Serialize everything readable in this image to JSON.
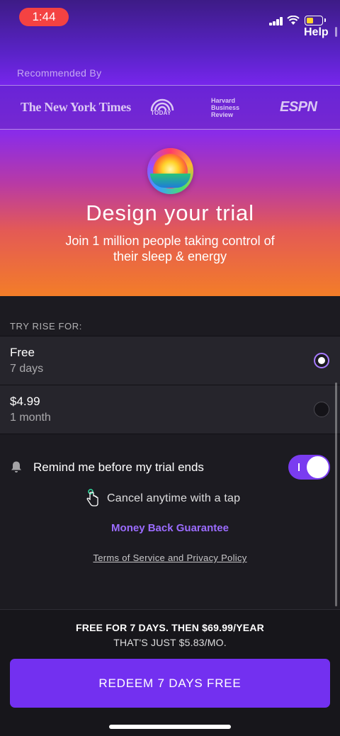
{
  "status_bar": {
    "time": "1:44",
    "help_label": "Help"
  },
  "press": {
    "label": "Recommended By",
    "logos": [
      "The New York Times",
      "TODAY",
      "Harvard Business Review",
      "ESPN"
    ]
  },
  "hero": {
    "title": "Design your trial",
    "subtitle_line1": "Join 1 million people taking control of",
    "subtitle_line2": "their sleep & energy"
  },
  "plans": {
    "section_label": "TRY RISE FOR:",
    "options": [
      {
        "title": "Free",
        "subtitle": "7 days",
        "selected": true
      },
      {
        "title": "$4.99",
        "subtitle": "1 month",
        "selected": false
      }
    ]
  },
  "reminder": {
    "label": "Remind me before my trial ends",
    "enabled": true
  },
  "cancel_note": "Cancel anytime with a tap",
  "guarantee_label": "Money Back Guarantee",
  "terms_label": "Terms of Service and Privacy Policy",
  "footer": {
    "price_line1": "FREE FOR 7 DAYS. THEN $69.99/YEAR",
    "price_line2": "THAT'S JUST $5.83/MO.",
    "cta_label": "REDEEM 7 DAYS FREE"
  },
  "colors": {
    "accent": "#7330f0",
    "guarantee": "#9b6cff",
    "time_pill": "#f44242"
  }
}
